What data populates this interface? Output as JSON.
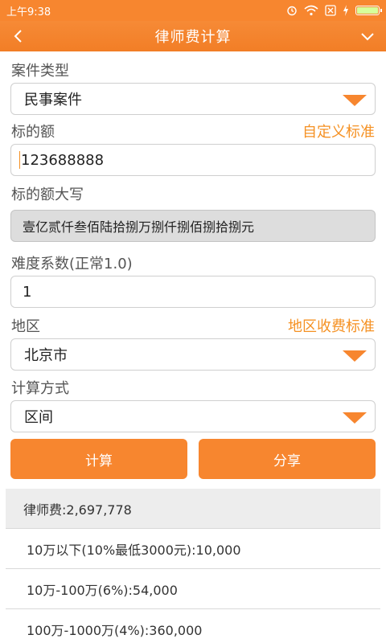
{
  "status": {
    "time": "上午9:38"
  },
  "appbar": {
    "title": "律师费计算"
  },
  "case_type": {
    "label": "案件类型",
    "value": "民事案件"
  },
  "amount": {
    "label": "标的额",
    "link": "自定义标准",
    "value": "123688888"
  },
  "amount_upper": {
    "label": "标的额大写",
    "value": "壹亿贰仟叁佰陆拾捌万捌仟捌佰捌拾捌元"
  },
  "difficulty": {
    "label": "难度系数(正常1.0)",
    "value": "1"
  },
  "region": {
    "label": "地区",
    "link": "地区收费标准",
    "value": "北京市"
  },
  "method": {
    "label": "计算方式",
    "value": "区间"
  },
  "buttons": {
    "calculate": "计算",
    "share": "分享"
  },
  "results": {
    "total": "律师费:2,697,778",
    "items": [
      "10万以下(10%最低3000元):10,000",
      "10万-100万(6%):54,000",
      "100万-1000万(4%):360,000"
    ]
  },
  "colors": {
    "accent": "#f7862f",
    "link": "#f59123"
  }
}
